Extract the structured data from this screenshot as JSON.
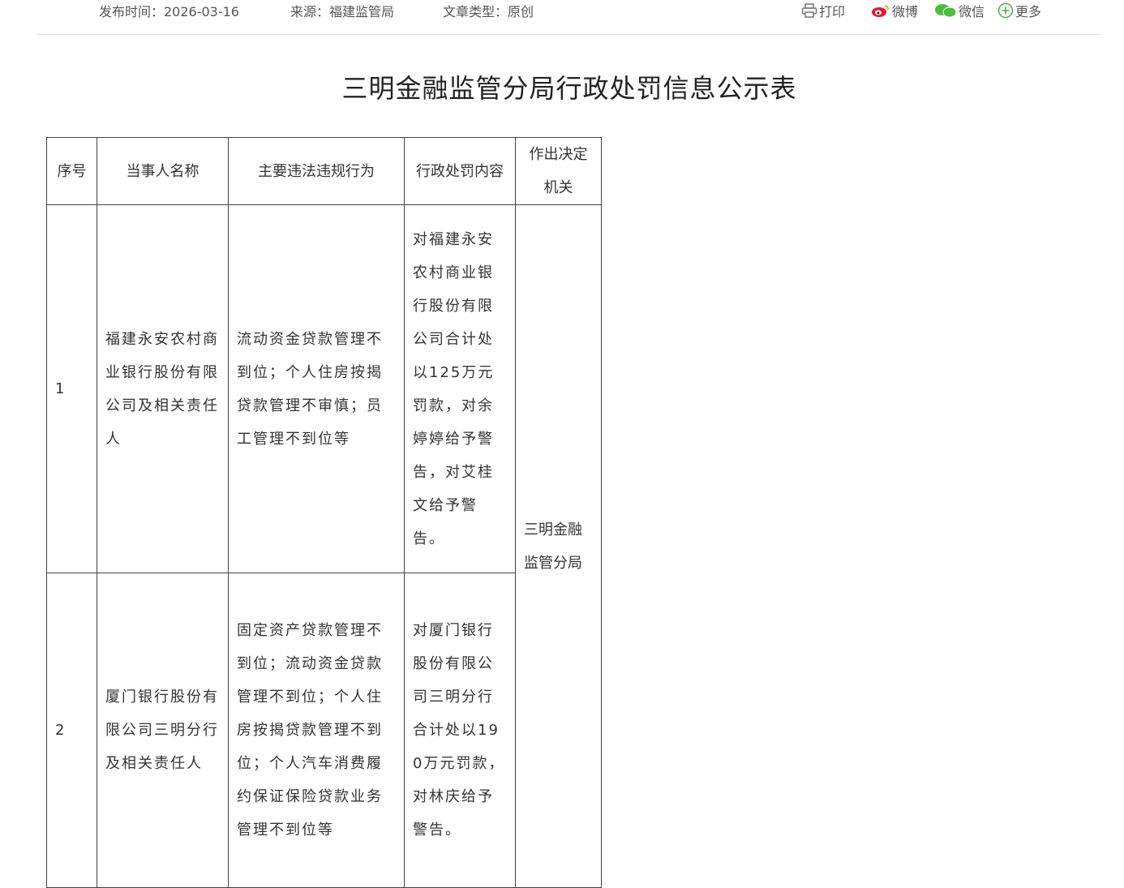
{
  "meta": {
    "publish_time": "发布时间：2026-03-16",
    "source": "来源：福建监管局",
    "article_type": "文章类型：原创"
  },
  "share": {
    "print": "打印",
    "weibo": "微博",
    "wechat": "微信",
    "more": "更多"
  },
  "page_title": "三明金融监管分局行政处罚信息公示表",
  "table": {
    "headers": {
      "seq": "序号",
      "party": "当事人名称",
      "violation": "主要违法违规行为",
      "penalty": "行政处罚内容",
      "authority": "作出决定机关"
    },
    "rows": [
      {
        "seq": "1",
        "party": "福建永安农村商业银行股份有限公司及相关责任人",
        "violation": "流动资金贷款管理不到位；个人住房按揭贷款管理不审慎；员工管理不到位等",
        "penalty": "对福建永安农村商业银行股份有限公司合计处以125万元罚款，对余婷婷给予警告，对艾桂文给予警告。"
      },
      {
        "seq": "2",
        "party": "厦门银行股份有限公司三明分行及相关责任人",
        "violation": "固定资产贷款管理不到位；流动资金贷款管理不到位；个人住房按揭贷款管理不到位；个人汽车消费履约保证保险贷款业务管理不到位等",
        "penalty": "对厦门银行股份有限公司三明分行合计处以190万元罚款，对林庆给予警告。"
      }
    ],
    "authority": "三明金融监管分局"
  }
}
